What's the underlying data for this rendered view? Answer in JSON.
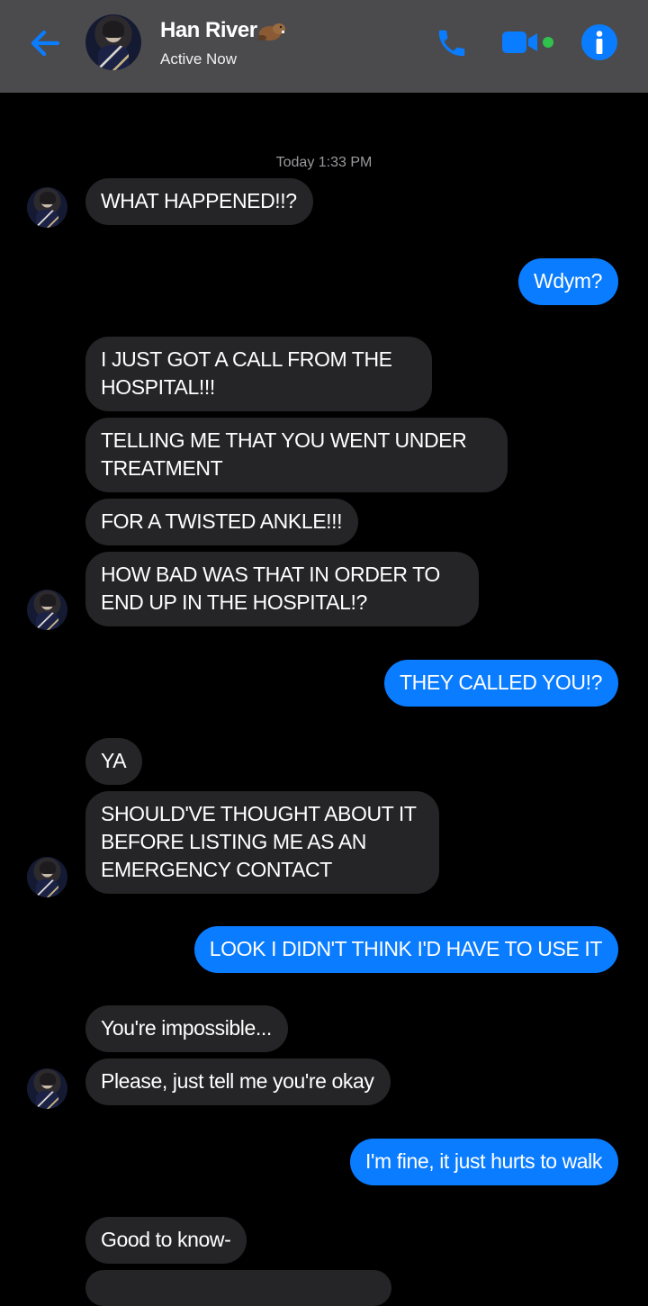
{
  "header": {
    "contact_name": "Han River",
    "status": "Active Now",
    "back_icon": "back-arrow-icon",
    "call_icon": "phone-icon",
    "video_icon": "video-camera-icon",
    "info_icon": "info-icon",
    "accent_color": "#0a7cff",
    "online_color": "#31c24d",
    "background_color": "#4b4b4d"
  },
  "chat": {
    "timestamp": "Today 1:33 PM",
    "incoming_color": "#252527",
    "outgoing_color": "#0a7cff",
    "messages": [
      {
        "from": "them",
        "text": "WHAT HAPPENED!!?"
      },
      {
        "from": "me",
        "text": "Wdym?"
      },
      {
        "from": "them",
        "text": "I JUST GOT A CALL FROM THE HOSPITAL!!!"
      },
      {
        "from": "them",
        "text": "TELLING ME THAT YOU WENT UNDER TREATMENT"
      },
      {
        "from": "them",
        "text": "FOR A TWISTED ANKLE!!!"
      },
      {
        "from": "them",
        "text": "HOW BAD WAS THAT IN ORDER TO END UP IN THE HOSPITAL!?"
      },
      {
        "from": "me",
        "text": "THEY CALLED YOU!?"
      },
      {
        "from": "them",
        "text": "YA"
      },
      {
        "from": "them",
        "text": "SHOULD'VE THOUGHT ABOUT IT BEFORE LISTING ME AS AN EMERGENCY CONTACT"
      },
      {
        "from": "me",
        "text": "LOOK I DIDN'T THINK I'D HAVE TO USE IT"
      },
      {
        "from": "them",
        "text": "You're impossible..."
      },
      {
        "from": "them",
        "text": "Please, just tell me you're okay"
      },
      {
        "from": "me",
        "text": "I'm fine, it just hurts to walk"
      },
      {
        "from": "them",
        "text": "Good to know-"
      }
    ]
  }
}
